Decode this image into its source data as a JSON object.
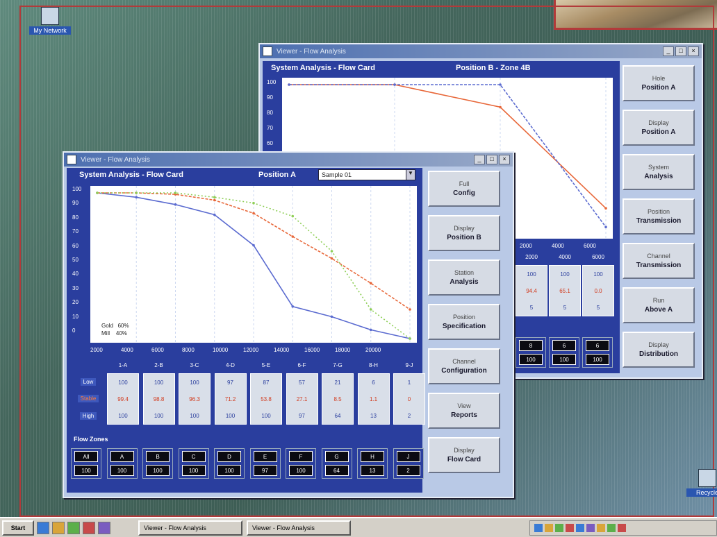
{
  "desktop": {
    "icons": [
      {
        "name": "my-computer-icon",
        "label": "My Network"
      },
      {
        "name": "recycle-bin-icon",
        "label": "Recycle"
      }
    ]
  },
  "back_window": {
    "title": "Viewer - Flow Analysis",
    "header_left": "System Analysis - Flow Card",
    "header_right": "Position B - Zone 4B",
    "y_ticks": [
      "100",
      "90",
      "80",
      "70",
      "60"
    ],
    "x_ticks": [
      "2000",
      "4000",
      "6000"
    ],
    "col_heads": [
      "2000",
      "4000",
      "6000"
    ],
    "cells": [
      {
        "top": "100",
        "mid": "94.4",
        "bot": "5"
      },
      {
        "top": "100",
        "mid": "65.1",
        "bot": "5"
      },
      {
        "top": "100",
        "mid": "0.0",
        "bot": "5"
      }
    ],
    "blocks": [
      {
        "a": "8",
        "b": "100"
      },
      {
        "a": "6",
        "b": "100"
      },
      {
        "a": "6",
        "b": "100"
      }
    ],
    "buttons": [
      {
        "l1": "Hole",
        "l2": "Position A"
      },
      {
        "l1": "Display",
        "l2": "Position A"
      },
      {
        "l1": "System",
        "l2": "Analysis"
      },
      {
        "l1": "Position",
        "l2": "Transmission"
      },
      {
        "l1": "Channel",
        "l2": "Transmission"
      },
      {
        "l1": "Run",
        "l2": "Above A"
      },
      {
        "l1": "Display",
        "l2": "Distribution"
      }
    ]
  },
  "front_window": {
    "title": "Viewer - Flow Analysis",
    "header_left": "System Analysis - Flow Card",
    "header_mid": "Position A",
    "dropdown_value": "Sample 01",
    "y_ticks": [
      "100",
      "90",
      "80",
      "70",
      "60",
      "50",
      "40",
      "30",
      "20",
      "10",
      "0"
    ],
    "x_ticks": [
      "2000",
      "4000",
      "6000",
      "8000",
      "10000",
      "12000",
      "14000",
      "16000",
      "18000",
      "20000"
    ],
    "legend": [
      {
        "k": "Gold",
        "v": "60%"
      },
      {
        "k": "Mill",
        "v": "40%"
      }
    ],
    "col_heads": [
      "1-A",
      "2-B",
      "3-C",
      "4-D",
      "5-E",
      "6-F",
      "7-G",
      "8-H",
      "9-J"
    ],
    "row_labels": [
      "Low",
      "Stable",
      "High"
    ],
    "cells": [
      {
        "top": "100",
        "mid": "99.4",
        "bot": "100"
      },
      {
        "top": "100",
        "mid": "98.8",
        "bot": "100"
      },
      {
        "top": "100",
        "mid": "96.3",
        "bot": "100"
      },
      {
        "top": "97",
        "mid": "71.2",
        "bot": "100"
      },
      {
        "top": "87",
        "mid": "53.8",
        "bot": "100"
      },
      {
        "top": "57",
        "mid": "27.1",
        "bot": "97"
      },
      {
        "top": "21",
        "mid": "8.5",
        "bot": "64"
      },
      {
        "top": "6",
        "mid": "1.1",
        "bot": "13"
      },
      {
        "top": "1",
        "mid": "0",
        "bot": "2"
      }
    ],
    "blocks_label": "Flow Zones",
    "blocks": [
      {
        "a": "All",
        "b": "100"
      },
      {
        "a": "A",
        "b": "100"
      },
      {
        "a": "B",
        "b": "100"
      },
      {
        "a": "C",
        "b": "100"
      },
      {
        "a": "D",
        "b": "100"
      },
      {
        "a": "E",
        "b": "97"
      },
      {
        "a": "F",
        "b": "100"
      },
      {
        "a": "G",
        "b": "64"
      },
      {
        "a": "H",
        "b": "13"
      },
      {
        "a": "J",
        "b": "2"
      }
    ],
    "buttons": [
      {
        "l1": "Full",
        "l2": "Config"
      },
      {
        "l1": "Display",
        "l2": "Position B"
      },
      {
        "l1": "Station",
        "l2": "Analysis"
      },
      {
        "l1": "Position",
        "l2": "Specification"
      },
      {
        "l1": "Channel",
        "l2": "Configuration"
      },
      {
        "l1": "View",
        "l2": "Reports"
      },
      {
        "l1": "Display",
        "l2": "Flow Card"
      }
    ]
  },
  "taskbar": {
    "start": "Start",
    "tasks": [
      "Viewer - Flow Analysis",
      "Viewer - Flow Analysis"
    ]
  },
  "chart_data": [
    {
      "type": "line",
      "title": "System Analysis - Flow Card",
      "x": [
        0,
        2000,
        4000,
        6000,
        8000,
        10000,
        12000,
        14000,
        16000
      ],
      "ylim": [
        0,
        100
      ],
      "series": [
        {
          "name": "Gold",
          "color": "#5b6bd0",
          "values": [
            100,
            97,
            92,
            85,
            64,
            22,
            15,
            6,
            0
          ]
        },
        {
          "name": "Mill",
          "color": "#e8683a",
          "values": [
            100,
            100,
            99,
            95,
            86,
            70,
            55,
            38,
            20
          ]
        },
        {
          "name": "",
          "color": "#8fcf58",
          "values": [
            100,
            100,
            100,
            97,
            93,
            84,
            60,
            20,
            0
          ]
        }
      ]
    },
    {
      "type": "line",
      "title": "Position B - Zone 4B",
      "x": [
        0,
        2000,
        4000,
        6000
      ],
      "ylim": [
        60,
        100
      ],
      "series": [
        {
          "name": "",
          "color": "#e8683a",
          "values": [
            100,
            100,
            94,
            67
          ]
        },
        {
          "name": "",
          "color": "#5b6bd0",
          "values": [
            100,
            100,
            100,
            62
          ]
        }
      ]
    }
  ]
}
